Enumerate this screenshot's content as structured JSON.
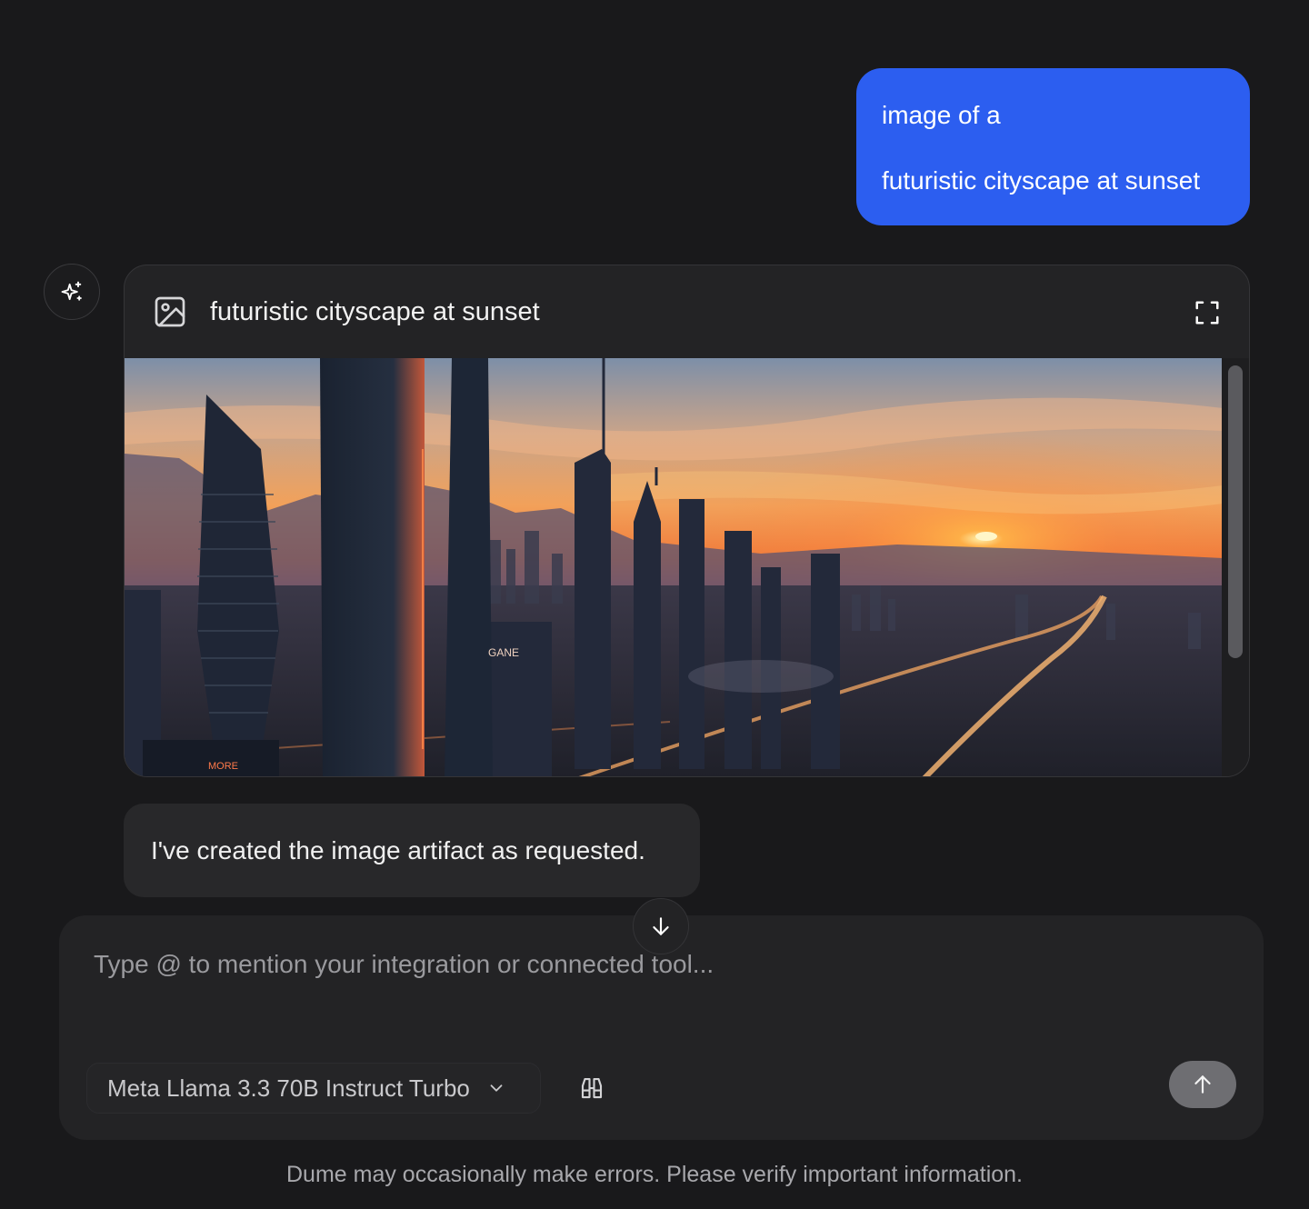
{
  "messages": {
    "user": {
      "line1": "image of a",
      "line2": "futuristic cityscape at sunset"
    },
    "assistant": {
      "avatar_icon": "sparkles-icon",
      "artifact": {
        "icon": "image-icon",
        "title": "futuristic cityscape at sunset",
        "expand_icon": "expand-icon",
        "image_signs": [
          "GANE",
          "MORE"
        ]
      },
      "reply": "I've created the image artifact as requested."
    }
  },
  "composer": {
    "placeholder": "Type @ to mention your integration or connected tool...",
    "value": "",
    "model": "Meta Llama 3.3 70B Instruct Turbo",
    "model_icon": "chevron-down-icon",
    "research_icon": "binoculars-icon",
    "send_icon": "arrow-up-icon",
    "scroll_icon": "arrow-down-icon"
  },
  "footer": {
    "disclaimer": "Dume may occasionally make errors. Please verify important information."
  },
  "colors": {
    "background": "#19191b",
    "user_bubble": "#2c5ef0",
    "card": "#232325",
    "send_button": "#6e6e72"
  }
}
